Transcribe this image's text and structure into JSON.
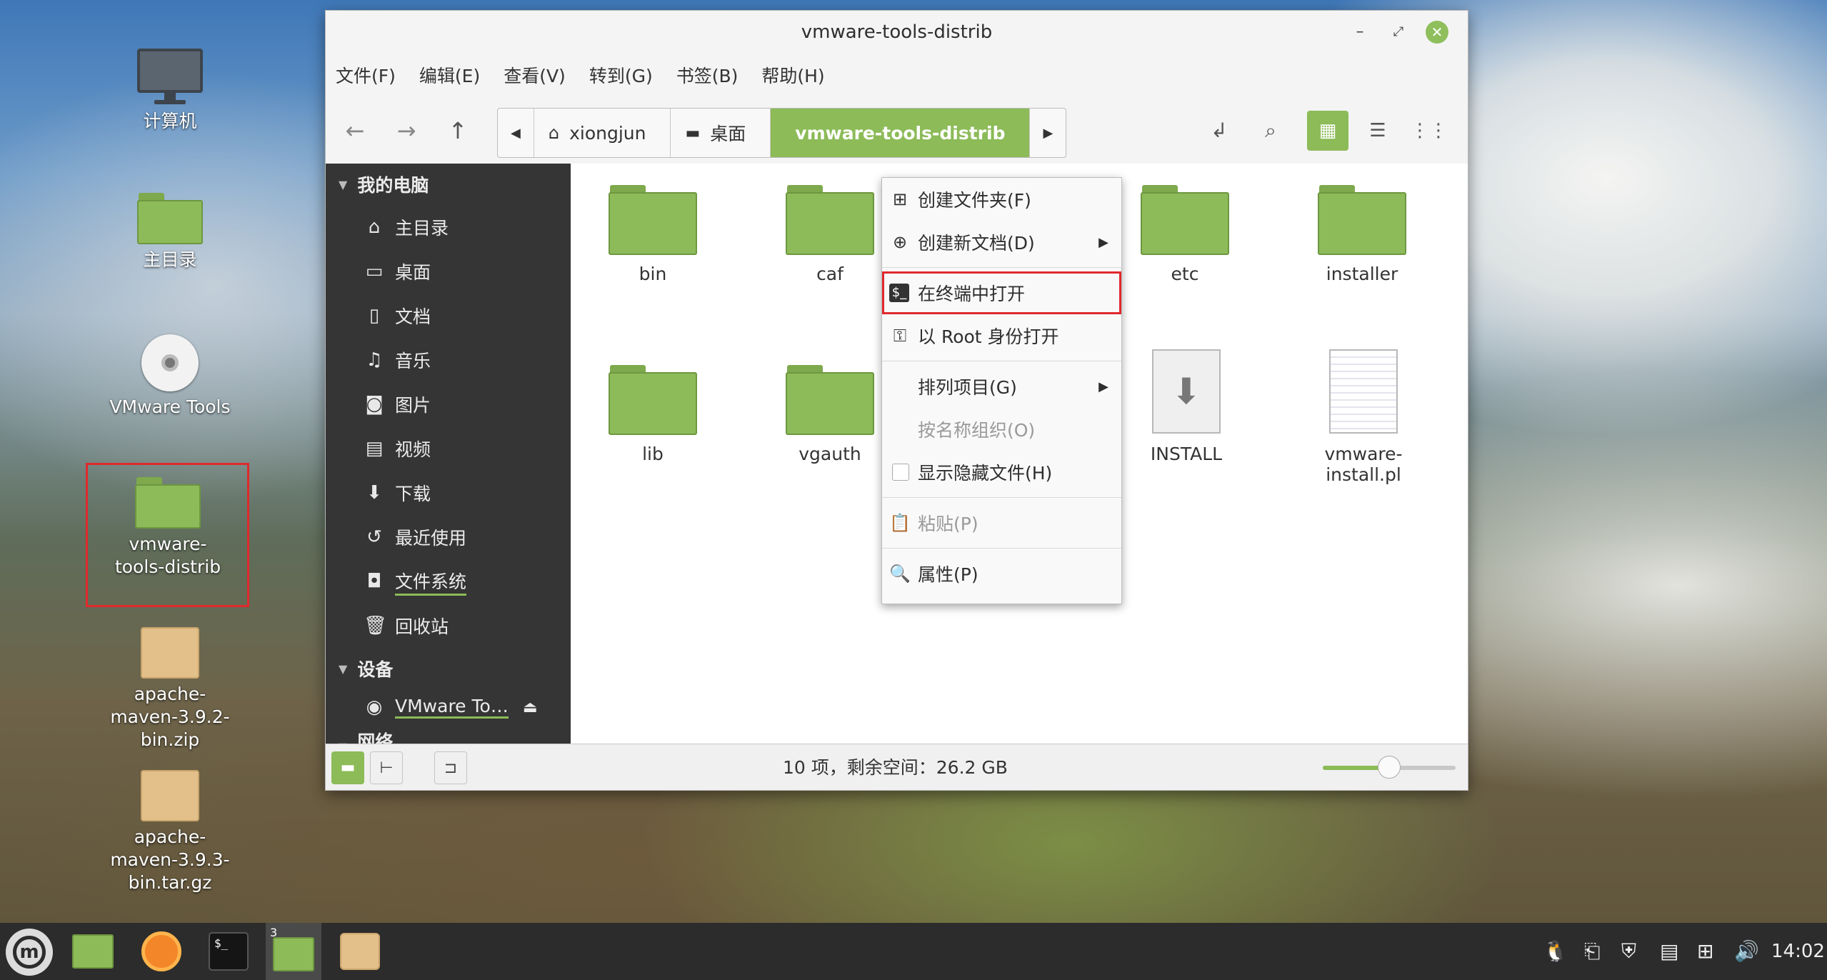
{
  "desktop": {
    "icons": [
      {
        "label": "计算机"
      },
      {
        "label": "主目录"
      },
      {
        "label": "VMware Tools"
      },
      {
        "label": "vmware-tools-distrib"
      },
      {
        "label": "apache-maven-3.9.2-bin.zip"
      },
      {
        "label": "apache-maven-3.9.3-bin.tar.gz"
      }
    ]
  },
  "window": {
    "title": "vmware-tools-distrib",
    "menu": [
      "文件(F)",
      "编辑(E)",
      "查看(V)",
      "转到(G)",
      "书签(B)",
      "帮助(H)"
    ],
    "breadcrumbs": [
      "xiongjun",
      "桌面",
      "vmware-tools-distrib"
    ],
    "sidebar": {
      "section_computer": "我的电脑",
      "items": [
        "主目录",
        "桌面",
        "文档",
        "音乐",
        "图片",
        "视频",
        "下载",
        "最近使用",
        "文件系统",
        "回收站"
      ],
      "section_devices": "设备",
      "device": "VMware To…",
      "section_network": "网络"
    },
    "files": [
      "bin",
      "caf",
      "etc",
      "installer",
      "lib",
      "vgauth",
      "INSTALL",
      "vmware-install.pl"
    ],
    "status": "10 项，剩余空间：26.2 GB",
    "zoom_level": 0.5
  },
  "context_menu": {
    "items": [
      "创建文件夹(F)",
      "创建新文档(D)",
      "在终端中打开",
      "以 Root 身份打开",
      "排列项目(G)",
      "按名称组织(O)",
      "显示隐藏文件(H)",
      "粘贴(P)",
      "属性(P)"
    ]
  },
  "taskbar": {
    "clock": "14:02",
    "workspace_badge": "3"
  },
  "colors": {
    "accent": "#8cbb58",
    "highlight": "#e0292c",
    "sidebar": "#353535"
  }
}
